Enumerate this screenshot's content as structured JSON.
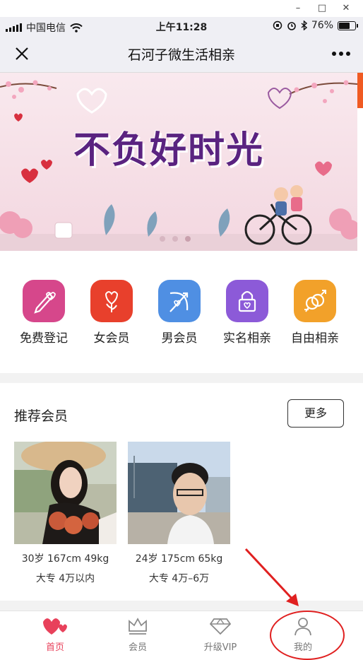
{
  "window": {
    "controls": [
      "–",
      "□",
      "✕"
    ]
  },
  "status_bar": {
    "carrier": "中国电信",
    "time": "上午11:28",
    "battery": "76%",
    "battery_level": 0.76
  },
  "nav": {
    "title": "石河子微生活相亲"
  },
  "banner": {
    "headline": "不负好时光",
    "slides": 3,
    "active_slide": 2
  },
  "categories": [
    {
      "label": "免费登记",
      "icon": "pen-heart-icon",
      "color": "#d6478b"
    },
    {
      "label": "女会员",
      "icon": "rose-icon",
      "color": "#e8402c"
    },
    {
      "label": "男会员",
      "icon": "bow-arrow-icon",
      "color": "#4f8fe3"
    },
    {
      "label": "实名相亲",
      "icon": "lock-heart-icon",
      "color": "#8c5ad8"
    },
    {
      "label": "自由相亲",
      "icon": "rings-gender-icon",
      "color": "#f2a12a"
    }
  ],
  "recommended": {
    "heading": "推荐会员",
    "more_label": "更多",
    "members": [
      {
        "line1": "30岁 167cm 49kg",
        "line2": "大专 4万以内"
      },
      {
        "line1": "24岁 175cm 65kg",
        "line2": "大专 4万–6万"
      }
    ]
  },
  "tabbar": {
    "tabs": [
      {
        "label": "首页",
        "icon": "hearts-icon",
        "active": true
      },
      {
        "label": "会员",
        "icon": "crown-icon",
        "active": false
      },
      {
        "label": "升级VIP",
        "icon": "diamond-icon",
        "active": false
      },
      {
        "label": "我的",
        "icon": "user-icon",
        "active": false
      }
    ]
  },
  "colors": {
    "accent": "#e8415b",
    "annotation": "#e02020"
  }
}
